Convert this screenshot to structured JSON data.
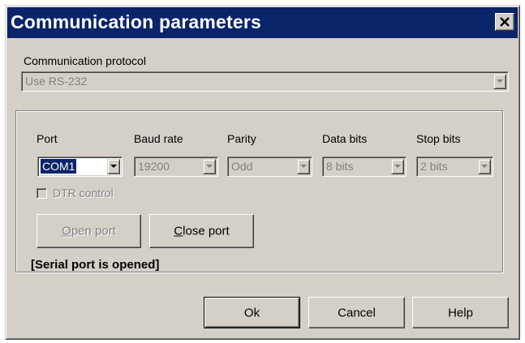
{
  "window": {
    "title": "Communication parameters",
    "close_symbol": "close-icon"
  },
  "protocol": {
    "label": "Communication protocol",
    "value": "Use RS-232"
  },
  "serial": {
    "port": {
      "label": "Port",
      "value": "COM1"
    },
    "baud_rate": {
      "label": "Baud rate",
      "value": "19200"
    },
    "parity": {
      "label": "Parity",
      "value": "Odd"
    },
    "data_bits": {
      "label": "Data bits",
      "value": "8 bits"
    },
    "stop_bits": {
      "label": "Stop bits",
      "value": "2 bits"
    },
    "dtr": {
      "label": "DTR control",
      "checked": false
    },
    "open_port": {
      "first": "O",
      "rest": "pen port"
    },
    "close_port": {
      "first": "C",
      "rest": "lose port"
    },
    "status": "[Serial port is opened]"
  },
  "buttons": {
    "ok": "Ok",
    "cancel": "Cancel",
    "help": "Help"
  },
  "colors": {
    "titlebar": "#0a246a",
    "face": "#d4d0c8",
    "disabled_text": "#808080"
  }
}
